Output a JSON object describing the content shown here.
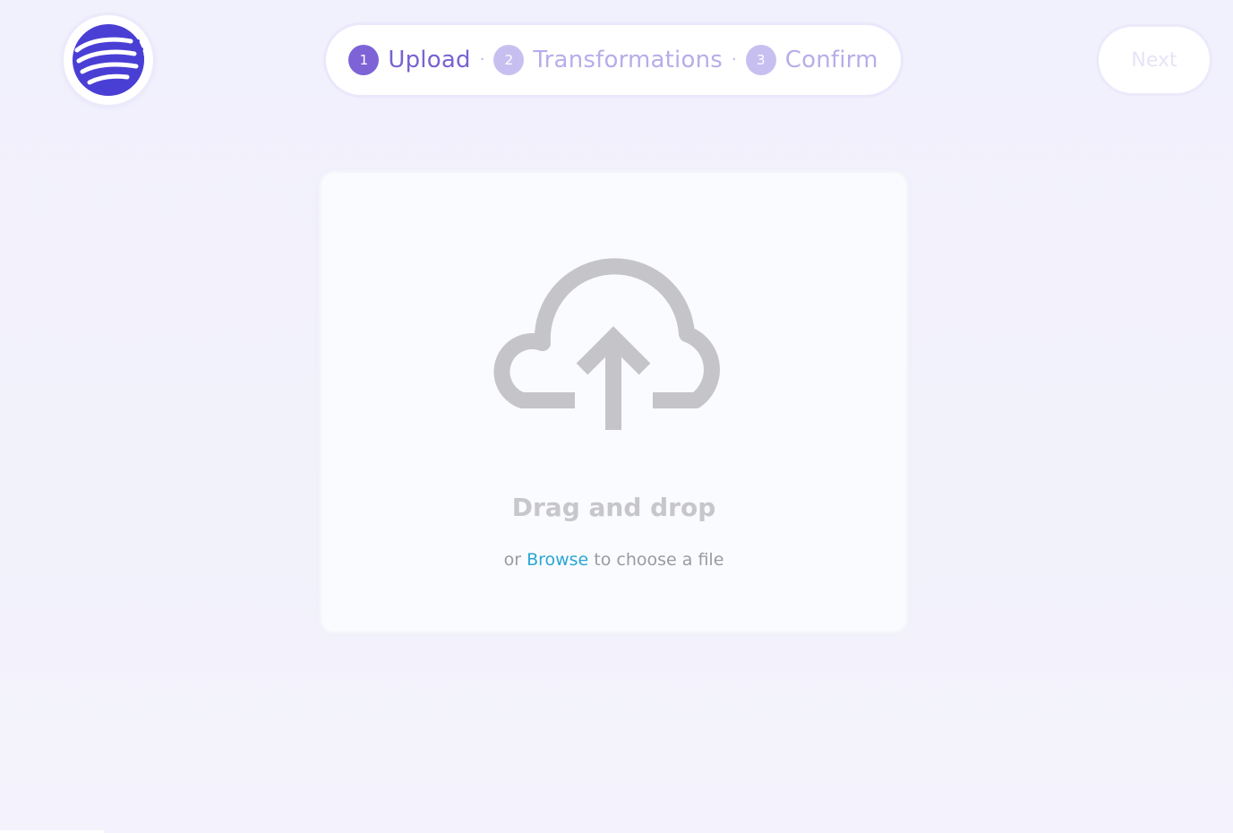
{
  "brand": {
    "logo_icon": "globe-lines-logo",
    "accent_color": "#5b49d6"
  },
  "stepper": {
    "steps": [
      {
        "number": "1",
        "label": "Upload",
        "active": true
      },
      {
        "number": "2",
        "label": "Transformations",
        "active": false
      },
      {
        "number": "3",
        "label": "Confirm",
        "active": false
      }
    ],
    "separator": "·",
    "active_color": "#7a62d0",
    "inactive_color": "#b6aee9"
  },
  "next_button": {
    "label": "Next",
    "state": "disabled"
  },
  "upload": {
    "icon": "cloud-upload-icon",
    "title": "Drag and drop",
    "sub_prefix": "or",
    "browse_label": "Browse",
    "sub_suffix": "to choose a file",
    "link_color": "#2aa6d6"
  }
}
